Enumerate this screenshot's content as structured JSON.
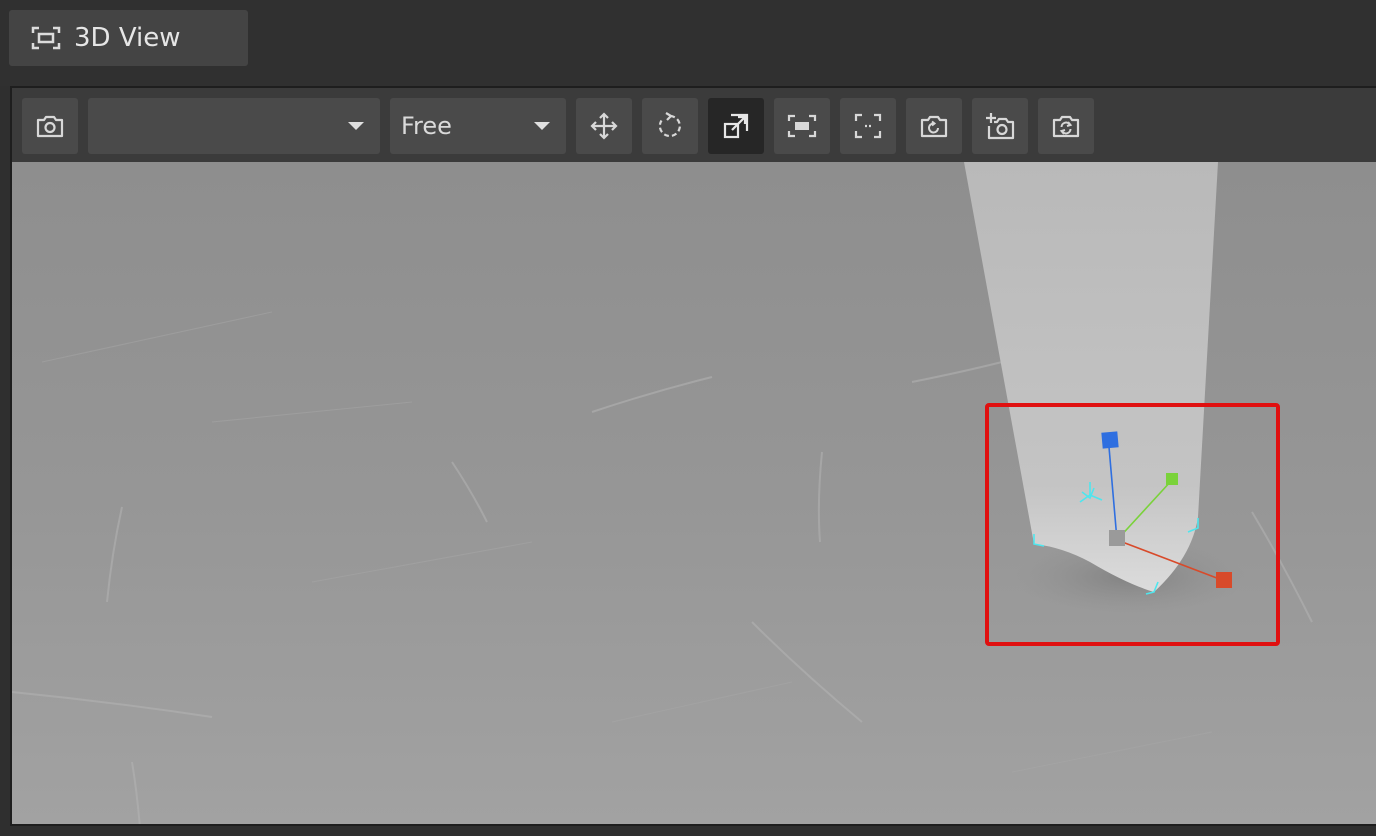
{
  "tab": {
    "label": "3D View",
    "icon": "frame-icon"
  },
  "toolbar": {
    "camera_button_icon": "camera-icon",
    "camera_select": {
      "value": ""
    },
    "mode_select": {
      "value": "Free"
    },
    "tools": [
      {
        "name": "move-tool",
        "icon": "move-arrows-icon"
      },
      {
        "name": "rotate-tool",
        "icon": "rotate-icon"
      },
      {
        "name": "scale-tool",
        "icon": "scale-icon",
        "active": true
      },
      {
        "name": "frame-selection",
        "icon": "frame-selection-icon"
      },
      {
        "name": "frame-all",
        "icon": "frame-all-icon"
      },
      {
        "name": "reset-camera",
        "icon": "camera-reset-icon"
      },
      {
        "name": "add-camera",
        "icon": "camera-add-icon"
      },
      {
        "name": "sync-camera",
        "icon": "camera-sync-icon"
      }
    ]
  },
  "scene": {
    "highlight_color": "#e01010",
    "gizmo_colors": {
      "x": "#d84a2a",
      "y": "#7ad23a",
      "z": "#2f6fe0",
      "bounds": "#4ee6ee"
    }
  }
}
